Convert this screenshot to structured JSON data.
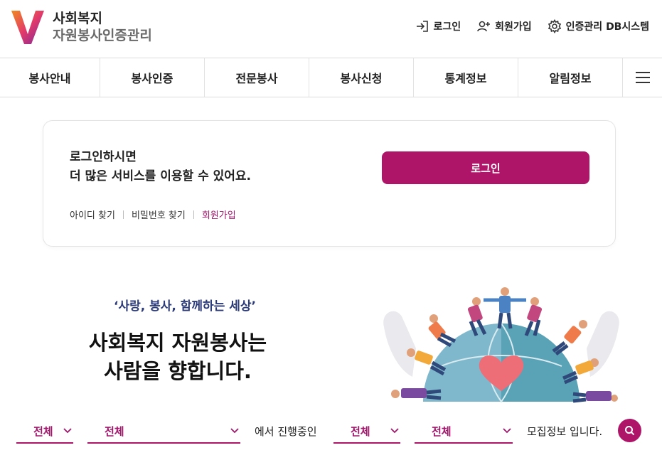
{
  "header": {
    "logo_line1": "사회복지",
    "logo_line2": "자원봉사인증관리",
    "utility": [
      {
        "label": "로그인",
        "icon": "login-icon"
      },
      {
        "label": "회원가입",
        "icon": "add-user-icon"
      },
      {
        "label": "인증관리 DB시스템",
        "icon": "gear-icon"
      }
    ]
  },
  "nav": {
    "items": [
      "봉사안내",
      "봉사인증",
      "전문봉사",
      "봉사신청",
      "통계정보",
      "알림정보"
    ],
    "menu_icon": "hamburger-icon"
  },
  "login_card": {
    "message_line1": "로그인하시면",
    "message_line2": "더 많은 서비스를 이용할 수 있어요.",
    "links": [
      "아이디 찾기",
      "비밀번호 찾기",
      "회원가입"
    ],
    "login_button": "로그인"
  },
  "slogan": {
    "sub": "‘사랑, 봉사, 함께하는 세상’",
    "main_line1": "사회복지 자원봉사는",
    "main_line2": "사람을 향합니다."
  },
  "search": {
    "select1": "전체",
    "select2": "전체",
    "text1": "에서 진행중인",
    "select3": "전체",
    "select4": "전체",
    "text2": "모집정보 입니다."
  },
  "colors": {
    "brand": "#ae1468",
    "slogan_sub": "#2b3a78"
  }
}
